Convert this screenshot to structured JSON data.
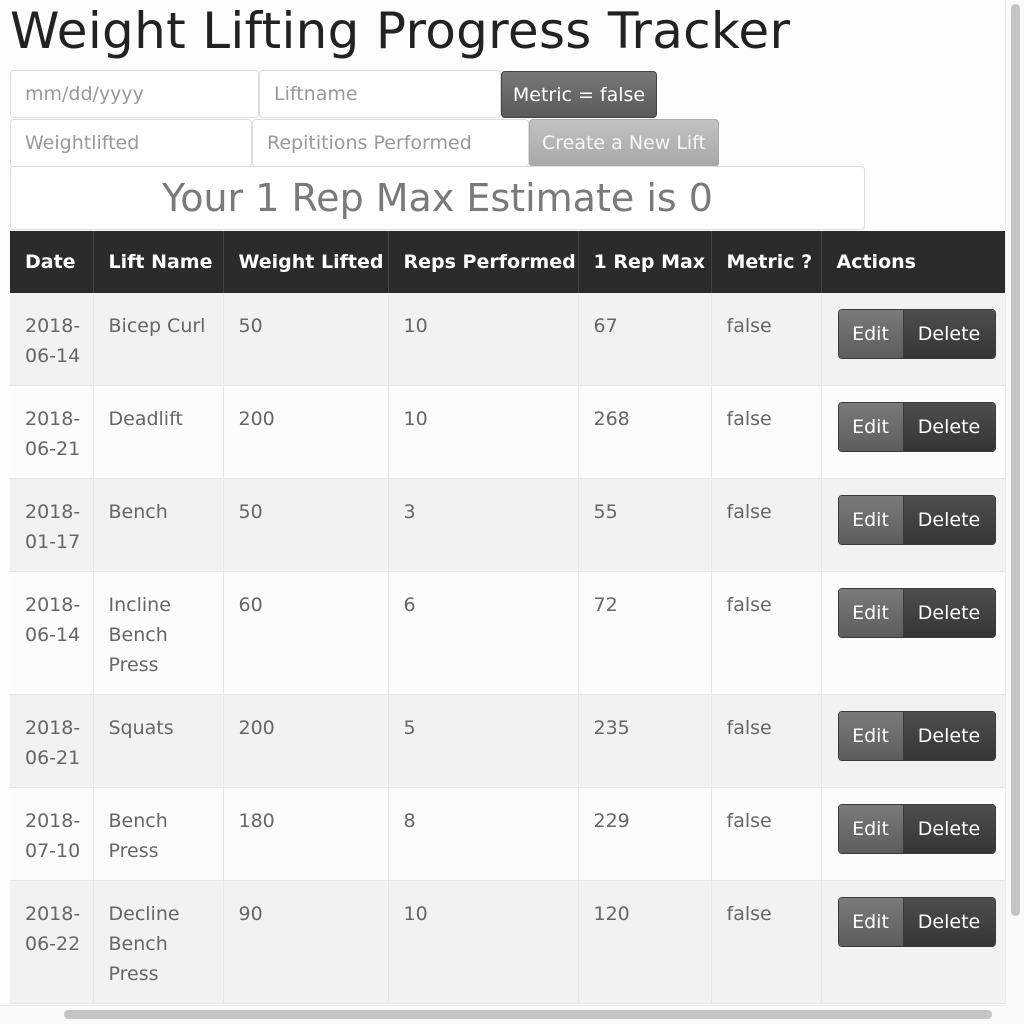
{
  "app": {
    "title": "Weight Lifting Progress Tracker"
  },
  "form": {
    "date_placeholder": "mm/dd/yyyy",
    "liftname_placeholder": "Liftname",
    "metric_button_label": "Metric = false",
    "weight_placeholder": "Weightlifted",
    "reps_placeholder": "Repititions Performed",
    "create_button_label": "Create a New Lift"
  },
  "estimate": {
    "text": "Your 1 Rep Max Estimate is 0"
  },
  "table": {
    "headers": [
      "Date",
      "Lift Name",
      "Weight Lifted",
      "Reps Performed",
      "1 Rep Max",
      "Metric ?",
      "Actions"
    ],
    "edit_label": "Edit",
    "delete_label": "Delete",
    "rows": [
      {
        "date": "2018-06-14",
        "lift": "Bicep Curl",
        "weight": "50",
        "reps": "10",
        "max": "67",
        "metric": "false"
      },
      {
        "date": "2018-06-21",
        "lift": "Deadlift",
        "weight": "200",
        "reps": "10",
        "max": "268",
        "metric": "false"
      },
      {
        "date": "2018-01-17",
        "lift": "Bench",
        "weight": "50",
        "reps": "3",
        "max": "55",
        "metric": "false"
      },
      {
        "date": "2018-06-14",
        "lift": "Incline Bench Press",
        "weight": "60",
        "reps": "6",
        "max": "72",
        "metric": "false"
      },
      {
        "date": "2018-06-21",
        "lift": "Squats",
        "weight": "200",
        "reps": "5",
        "max": "235",
        "metric": "false"
      },
      {
        "date": "2018-07-10",
        "lift": "Bench Press",
        "weight": "180",
        "reps": "8",
        "max": "229",
        "metric": "false"
      },
      {
        "date": "2018-06-22",
        "lift": "Decline Bench Press",
        "weight": "90",
        "reps": "10",
        "max": "120",
        "metric": "false"
      }
    ]
  }
}
